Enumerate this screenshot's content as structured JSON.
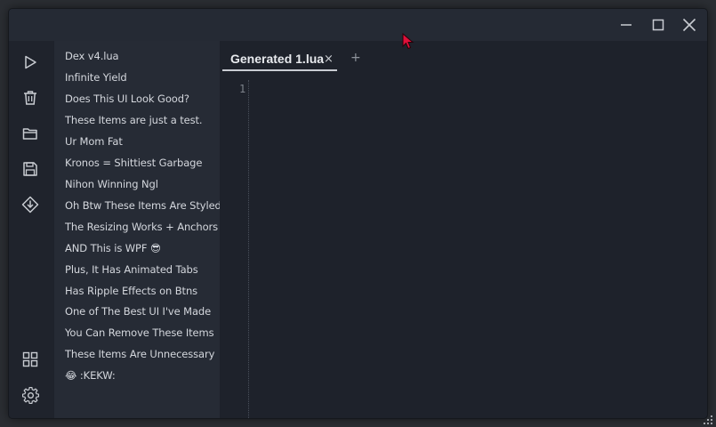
{
  "window": {
    "controls": {
      "minimize_icon": "minimize-icon",
      "maximize_icon": "maximize-icon",
      "close_icon": "close-icon"
    }
  },
  "sidebar_icons": [
    {
      "name": "execute-button",
      "icon": "play-icon"
    },
    {
      "name": "clear-button",
      "icon": "trash-icon"
    },
    {
      "name": "open-file-button",
      "icon": "folder-icon"
    },
    {
      "name": "save-file-button",
      "icon": "floppy-disk-icon"
    },
    {
      "name": "inject-button",
      "icon": "inject-icon"
    },
    {
      "name": "script-hub-button",
      "icon": "grid-icon"
    },
    {
      "name": "settings-button",
      "icon": "gear-icon"
    }
  ],
  "scripts": [
    "Dex v4.lua",
    "Infinite Yield",
    "Does This UI Look Good?",
    "These Items are just a test.",
    "Ur Mom Fat",
    "Kronos = Shittiest Garbage",
    "Nihon Winning Ngl",
    "Oh Btw These Items Are Styled",
    "The Resizing Works + Anchors",
    "AND This is WPF 😎",
    "Plus, It Has Animated Tabs",
    "Has Ripple Effects on Btns",
    "One of The Best UI I've Made",
    "You Can Remove These Items",
    "These Items Are Unnecessary",
    "😂 :KEKW:"
  ],
  "editor": {
    "tabs": [
      {
        "label": "Generated 1.lua",
        "close": "×"
      }
    ],
    "add_tab": "+",
    "line_numbers": [
      "1"
    ],
    "content": ""
  },
  "colors": {
    "window_bg": "#1e222b",
    "titlebar_bg": "#252a34",
    "list_bg": "#262b35",
    "text": "#d4d7dd",
    "cursor": "#e0103a"
  }
}
